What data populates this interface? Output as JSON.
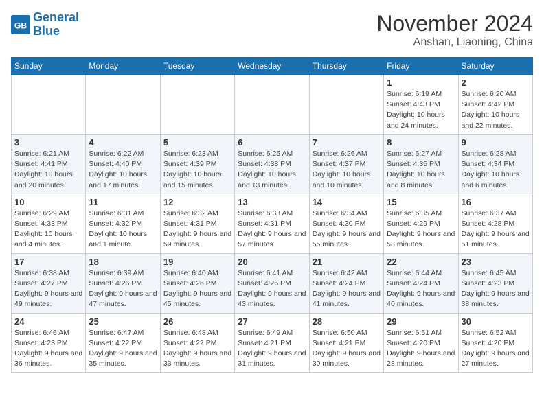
{
  "header": {
    "logo_line1": "General",
    "logo_line2": "Blue",
    "month": "November 2024",
    "location": "Anshan, Liaoning, China"
  },
  "weekdays": [
    "Sunday",
    "Monday",
    "Tuesday",
    "Wednesday",
    "Thursday",
    "Friday",
    "Saturday"
  ],
  "weeks": [
    [
      {
        "day": "",
        "info": ""
      },
      {
        "day": "",
        "info": ""
      },
      {
        "day": "",
        "info": ""
      },
      {
        "day": "",
        "info": ""
      },
      {
        "day": "",
        "info": ""
      },
      {
        "day": "1",
        "info": "Sunrise: 6:19 AM\nSunset: 4:43 PM\nDaylight: 10 hours and 24 minutes."
      },
      {
        "day": "2",
        "info": "Sunrise: 6:20 AM\nSunset: 4:42 PM\nDaylight: 10 hours and 22 minutes."
      }
    ],
    [
      {
        "day": "3",
        "info": "Sunrise: 6:21 AM\nSunset: 4:41 PM\nDaylight: 10 hours and 20 minutes."
      },
      {
        "day": "4",
        "info": "Sunrise: 6:22 AM\nSunset: 4:40 PM\nDaylight: 10 hours and 17 minutes."
      },
      {
        "day": "5",
        "info": "Sunrise: 6:23 AM\nSunset: 4:39 PM\nDaylight: 10 hours and 15 minutes."
      },
      {
        "day": "6",
        "info": "Sunrise: 6:25 AM\nSunset: 4:38 PM\nDaylight: 10 hours and 13 minutes."
      },
      {
        "day": "7",
        "info": "Sunrise: 6:26 AM\nSunset: 4:37 PM\nDaylight: 10 hours and 10 minutes."
      },
      {
        "day": "8",
        "info": "Sunrise: 6:27 AM\nSunset: 4:35 PM\nDaylight: 10 hours and 8 minutes."
      },
      {
        "day": "9",
        "info": "Sunrise: 6:28 AM\nSunset: 4:34 PM\nDaylight: 10 hours and 6 minutes."
      }
    ],
    [
      {
        "day": "10",
        "info": "Sunrise: 6:29 AM\nSunset: 4:33 PM\nDaylight: 10 hours and 4 minutes."
      },
      {
        "day": "11",
        "info": "Sunrise: 6:31 AM\nSunset: 4:32 PM\nDaylight: 10 hours and 1 minute."
      },
      {
        "day": "12",
        "info": "Sunrise: 6:32 AM\nSunset: 4:31 PM\nDaylight: 9 hours and 59 minutes."
      },
      {
        "day": "13",
        "info": "Sunrise: 6:33 AM\nSunset: 4:31 PM\nDaylight: 9 hours and 57 minutes."
      },
      {
        "day": "14",
        "info": "Sunrise: 6:34 AM\nSunset: 4:30 PM\nDaylight: 9 hours and 55 minutes."
      },
      {
        "day": "15",
        "info": "Sunrise: 6:35 AM\nSunset: 4:29 PM\nDaylight: 9 hours and 53 minutes."
      },
      {
        "day": "16",
        "info": "Sunrise: 6:37 AM\nSunset: 4:28 PM\nDaylight: 9 hours and 51 minutes."
      }
    ],
    [
      {
        "day": "17",
        "info": "Sunrise: 6:38 AM\nSunset: 4:27 PM\nDaylight: 9 hours and 49 minutes."
      },
      {
        "day": "18",
        "info": "Sunrise: 6:39 AM\nSunset: 4:26 PM\nDaylight: 9 hours and 47 minutes."
      },
      {
        "day": "19",
        "info": "Sunrise: 6:40 AM\nSunset: 4:26 PM\nDaylight: 9 hours and 45 minutes."
      },
      {
        "day": "20",
        "info": "Sunrise: 6:41 AM\nSunset: 4:25 PM\nDaylight: 9 hours and 43 minutes."
      },
      {
        "day": "21",
        "info": "Sunrise: 6:42 AM\nSunset: 4:24 PM\nDaylight: 9 hours and 41 minutes."
      },
      {
        "day": "22",
        "info": "Sunrise: 6:44 AM\nSunset: 4:24 PM\nDaylight: 9 hours and 40 minutes."
      },
      {
        "day": "23",
        "info": "Sunrise: 6:45 AM\nSunset: 4:23 PM\nDaylight: 9 hours and 38 minutes."
      }
    ],
    [
      {
        "day": "24",
        "info": "Sunrise: 6:46 AM\nSunset: 4:23 PM\nDaylight: 9 hours and 36 minutes."
      },
      {
        "day": "25",
        "info": "Sunrise: 6:47 AM\nSunset: 4:22 PM\nDaylight: 9 hours and 35 minutes."
      },
      {
        "day": "26",
        "info": "Sunrise: 6:48 AM\nSunset: 4:22 PM\nDaylight: 9 hours and 33 minutes."
      },
      {
        "day": "27",
        "info": "Sunrise: 6:49 AM\nSunset: 4:21 PM\nDaylight: 9 hours and 31 minutes."
      },
      {
        "day": "28",
        "info": "Sunrise: 6:50 AM\nSunset: 4:21 PM\nDaylight: 9 hours and 30 minutes."
      },
      {
        "day": "29",
        "info": "Sunrise: 6:51 AM\nSunset: 4:20 PM\nDaylight: 9 hours and 28 minutes."
      },
      {
        "day": "30",
        "info": "Sunrise: 6:52 AM\nSunset: 4:20 PM\nDaylight: 9 hours and 27 minutes."
      }
    ]
  ]
}
